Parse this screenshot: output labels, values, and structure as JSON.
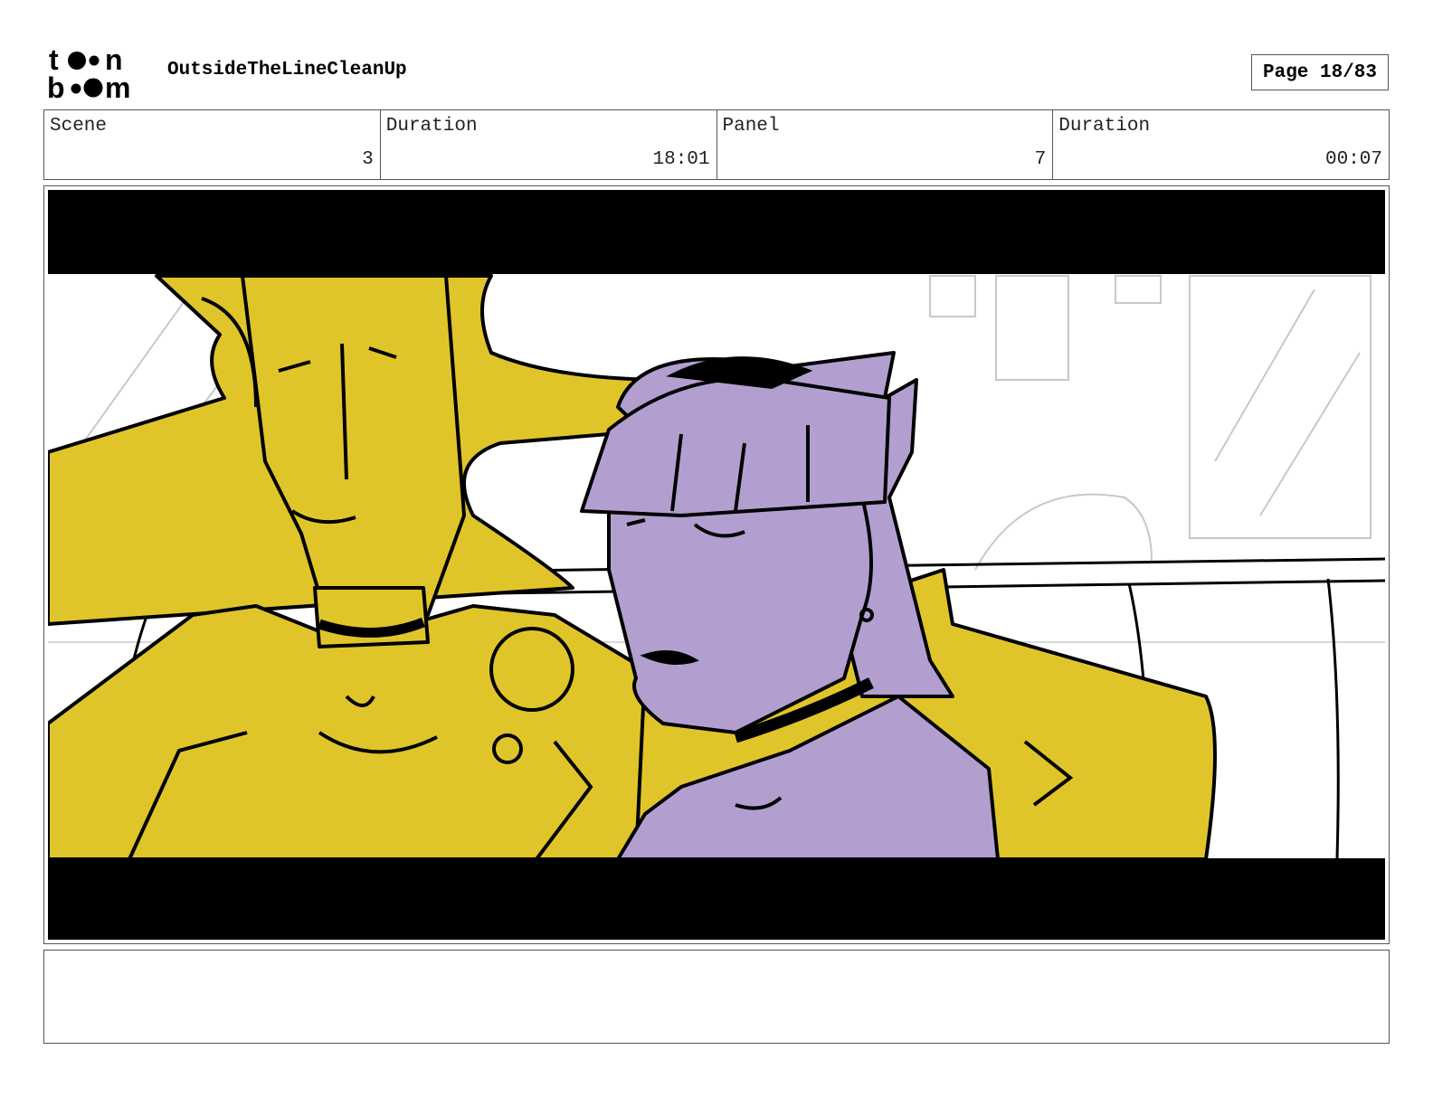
{
  "header": {
    "logo_text": "toonboom",
    "project_title": "OutsideTheLineCleanUp",
    "page_label": "Page 18/83"
  },
  "info": {
    "scene_label": "Scene",
    "scene_value": "3",
    "scene_duration_label": "Duration",
    "scene_duration_value": "18:01",
    "panel_label": "Panel",
    "panel_value": "7",
    "panel_duration_label": "Duration",
    "panel_duration_value": "00:07"
  },
  "colors": {
    "yellow_character": "#E0C52A",
    "purple_character": "#B39FCF",
    "letterbox": "#000000",
    "background_sketch": "#C8C8C8"
  },
  "notes": {
    "text": ""
  }
}
